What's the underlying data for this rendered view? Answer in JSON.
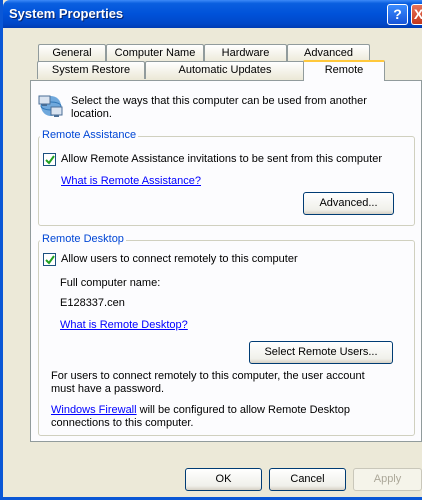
{
  "window": {
    "title": "System Properties",
    "help_glyph": "?",
    "close_glyph": "X"
  },
  "tabs": {
    "row1": [
      "General",
      "Computer Name",
      "Hardware",
      "Advanced"
    ],
    "row2": [
      "System Restore",
      "Automatic Updates",
      "Remote"
    ],
    "selected": "Remote"
  },
  "intro": {
    "text": "Select the ways that this computer can be used from another location.",
    "icon": "computers-network-icon"
  },
  "remote_assistance": {
    "legend": "Remote Assistance",
    "checkbox_label": "Allow Remote Assistance invitations to be sent from this computer",
    "checked": true,
    "link": "What is Remote Assistance?",
    "advanced_button": "Advanced..."
  },
  "remote_desktop": {
    "legend": "Remote Desktop",
    "checkbox_label": "Allow users to connect remotely to this computer",
    "checked": true,
    "computer_name_label": "Full computer name:",
    "computer_name": "E128337.cen",
    "link": "What is Remote Desktop?",
    "select_users_button": "Select Remote Users...",
    "note": "For users to connect remotely to this computer, the user account must have a password.",
    "firewall_link": "Windows Firewall",
    "firewall_text": " will be configured to allow Remote Desktop connections to this computer."
  },
  "buttons": {
    "ok": "OK",
    "cancel": "Cancel",
    "apply": "Apply"
  }
}
